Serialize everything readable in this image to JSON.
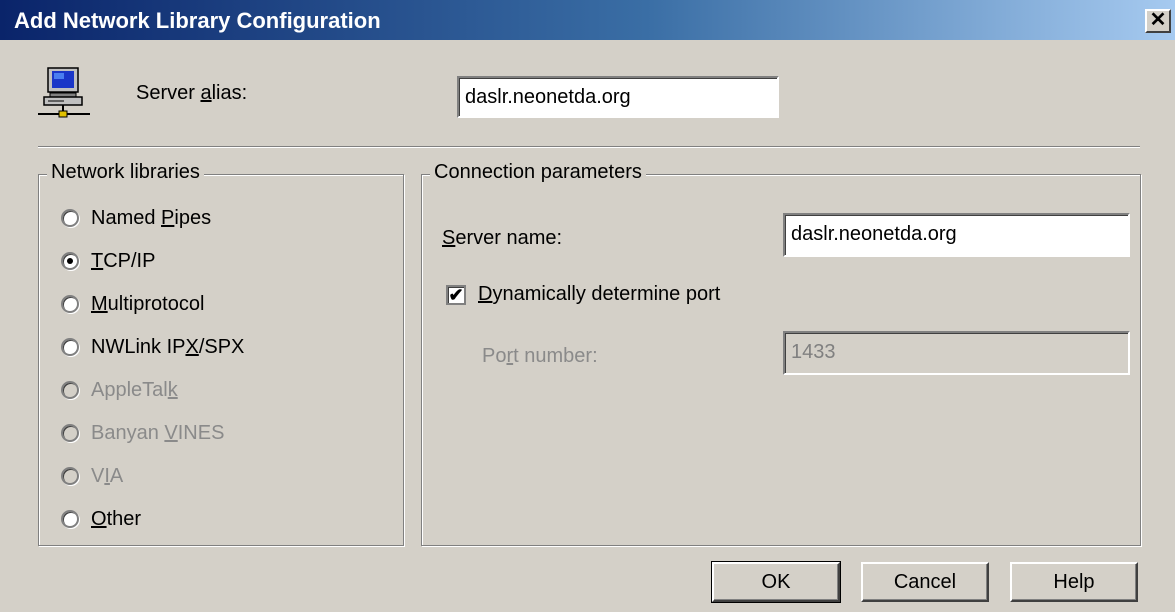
{
  "window": {
    "title": "Add Network Library Configuration",
    "close_glyph": "✕"
  },
  "alias": {
    "icon": "computer-network-icon",
    "label_pre": "Server ",
    "label_ul": "a",
    "label_post": "lias:",
    "value": "daslr.neonetda.org"
  },
  "network_libraries": {
    "title": "Network libraries",
    "options": [
      {
        "pre": "Named ",
        "ul": "P",
        "post": "ipes",
        "selected": false,
        "enabled": true
      },
      {
        "pre": "",
        "ul": "T",
        "post": "CP/IP",
        "selected": true,
        "enabled": true
      },
      {
        "pre": "",
        "ul": "M",
        "post": "ultiprotocol",
        "selected": false,
        "enabled": true
      },
      {
        "pre": "NWLink IP",
        "ul": "X",
        "post": "/SPX",
        "selected": false,
        "enabled": true
      },
      {
        "pre": "AppleTal",
        "ul": "k",
        "post": "",
        "selected": false,
        "enabled": false
      },
      {
        "pre": "Banyan ",
        "ul": "V",
        "post": "INES",
        "selected": false,
        "enabled": false
      },
      {
        "pre": "V",
        "ul": "I",
        "post": "A",
        "selected": false,
        "enabled": false
      },
      {
        "pre": "",
        "ul": "O",
        "post": "ther",
        "selected": false,
        "enabled": true
      }
    ]
  },
  "connection": {
    "title": "Connection parameters",
    "server_name_label_ul": "S",
    "server_name_label_post": "erver name:",
    "server_name_value": "daslr.neonetda.org",
    "dynamic_port_checked": true,
    "dynamic_port_label_ul": "D",
    "dynamic_port_label_post": "ynamically determine port",
    "port_label_pre": "Po",
    "port_label_ul": "r",
    "port_label_post": "t number:",
    "port_value": "1433"
  },
  "buttons": {
    "ok": "OK",
    "cancel": "Cancel",
    "help": "Help"
  }
}
